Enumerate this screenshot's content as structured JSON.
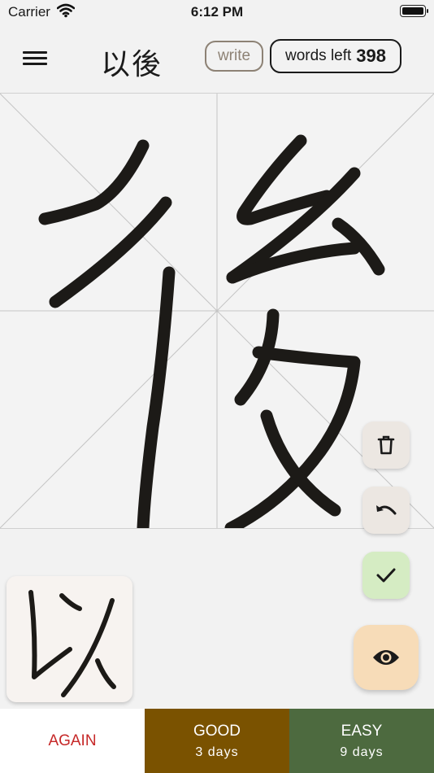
{
  "status_bar": {
    "carrier": "Carrier",
    "time": "6:12 PM"
  },
  "header": {
    "word": "以後",
    "mode": "write",
    "words_left_label": "words left",
    "words_left_count": "398"
  },
  "canvas": {
    "current_character": "後"
  },
  "preview": {
    "previous_character": "以"
  },
  "actions": {
    "delete_icon": "trash-icon",
    "undo_icon": "undo-icon",
    "check_icon": "check-icon",
    "reveal_icon": "eye-icon"
  },
  "grades": [
    {
      "label": "AGAIN",
      "interval": ""
    },
    {
      "label": "GOOD",
      "interval": "3 days"
    },
    {
      "label": "EASY",
      "interval": "9 days"
    }
  ],
  "colors": {
    "again": "#c62828",
    "good": "#7a5200",
    "easy": "#4d6a3f",
    "reveal": "#f7dcb8",
    "check": "#d5ecc3"
  }
}
